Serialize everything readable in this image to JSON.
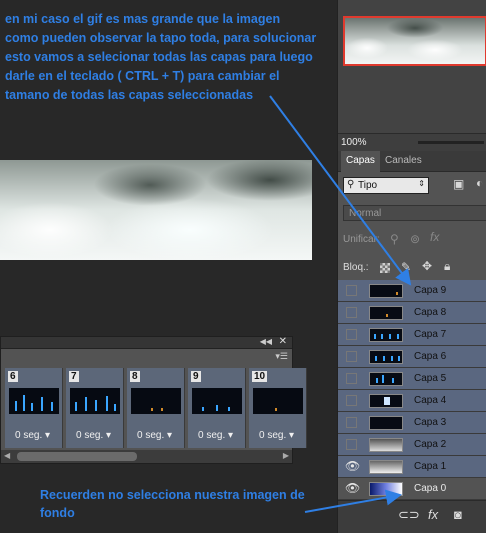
{
  "annotations": {
    "top_lines": [
      "en mi caso el gif es mas grande que la imagen",
      "como pueden observar la tapo toda, para solucionar",
      "esto vamos a selecionar todas las capas  para luego",
      "darle en el teclado ( CTRL + T) para cambiar el",
      "tamano de todas las capas seleccionadas"
    ],
    "bottom_lines": [
      "Recuerden no selecciona nuestra imagen de",
      "fondo"
    ],
    "color": "#2f7fe4"
  },
  "timeline": {
    "frames": [
      {
        "num": "6",
        "delay": "0 seg."
      },
      {
        "num": "7",
        "delay": "0 seg."
      },
      {
        "num": "8",
        "delay": "0 seg."
      },
      {
        "num": "9",
        "delay": "0 seg."
      },
      {
        "num": "10",
        "delay": "0 seg."
      }
    ]
  },
  "navigator": {
    "zoom": "100%"
  },
  "layers_panel": {
    "tabs": [
      "Capas",
      "Canales"
    ],
    "filter_label": "Tipo",
    "blend_mode": "Normal",
    "unify_label": "Unificar:",
    "lock_label": "Bloq.:",
    "layers": [
      {
        "name": "Capa 9",
        "visible": false,
        "selected": true
      },
      {
        "name": "Capa 8",
        "visible": false,
        "selected": true
      },
      {
        "name": "Capa 7",
        "visible": false,
        "selected": true
      },
      {
        "name": "Capa 6",
        "visible": false,
        "selected": true
      },
      {
        "name": "Capa 5",
        "visible": false,
        "selected": true
      },
      {
        "name": "Capa 4",
        "visible": false,
        "selected": true
      },
      {
        "name": "Capa 3",
        "visible": false,
        "selected": true
      },
      {
        "name": "Capa 2",
        "visible": false,
        "selected": true
      },
      {
        "name": "Capa 1",
        "visible": true,
        "selected": true
      },
      {
        "name": "Capa 0",
        "visible": true,
        "selected": false
      }
    ],
    "footer_icons": [
      "link-icon",
      "fx-icon",
      "mask-icon"
    ]
  },
  "colors": {
    "selection": "#5a6780",
    "accent_frame": "#e03a2e"
  }
}
